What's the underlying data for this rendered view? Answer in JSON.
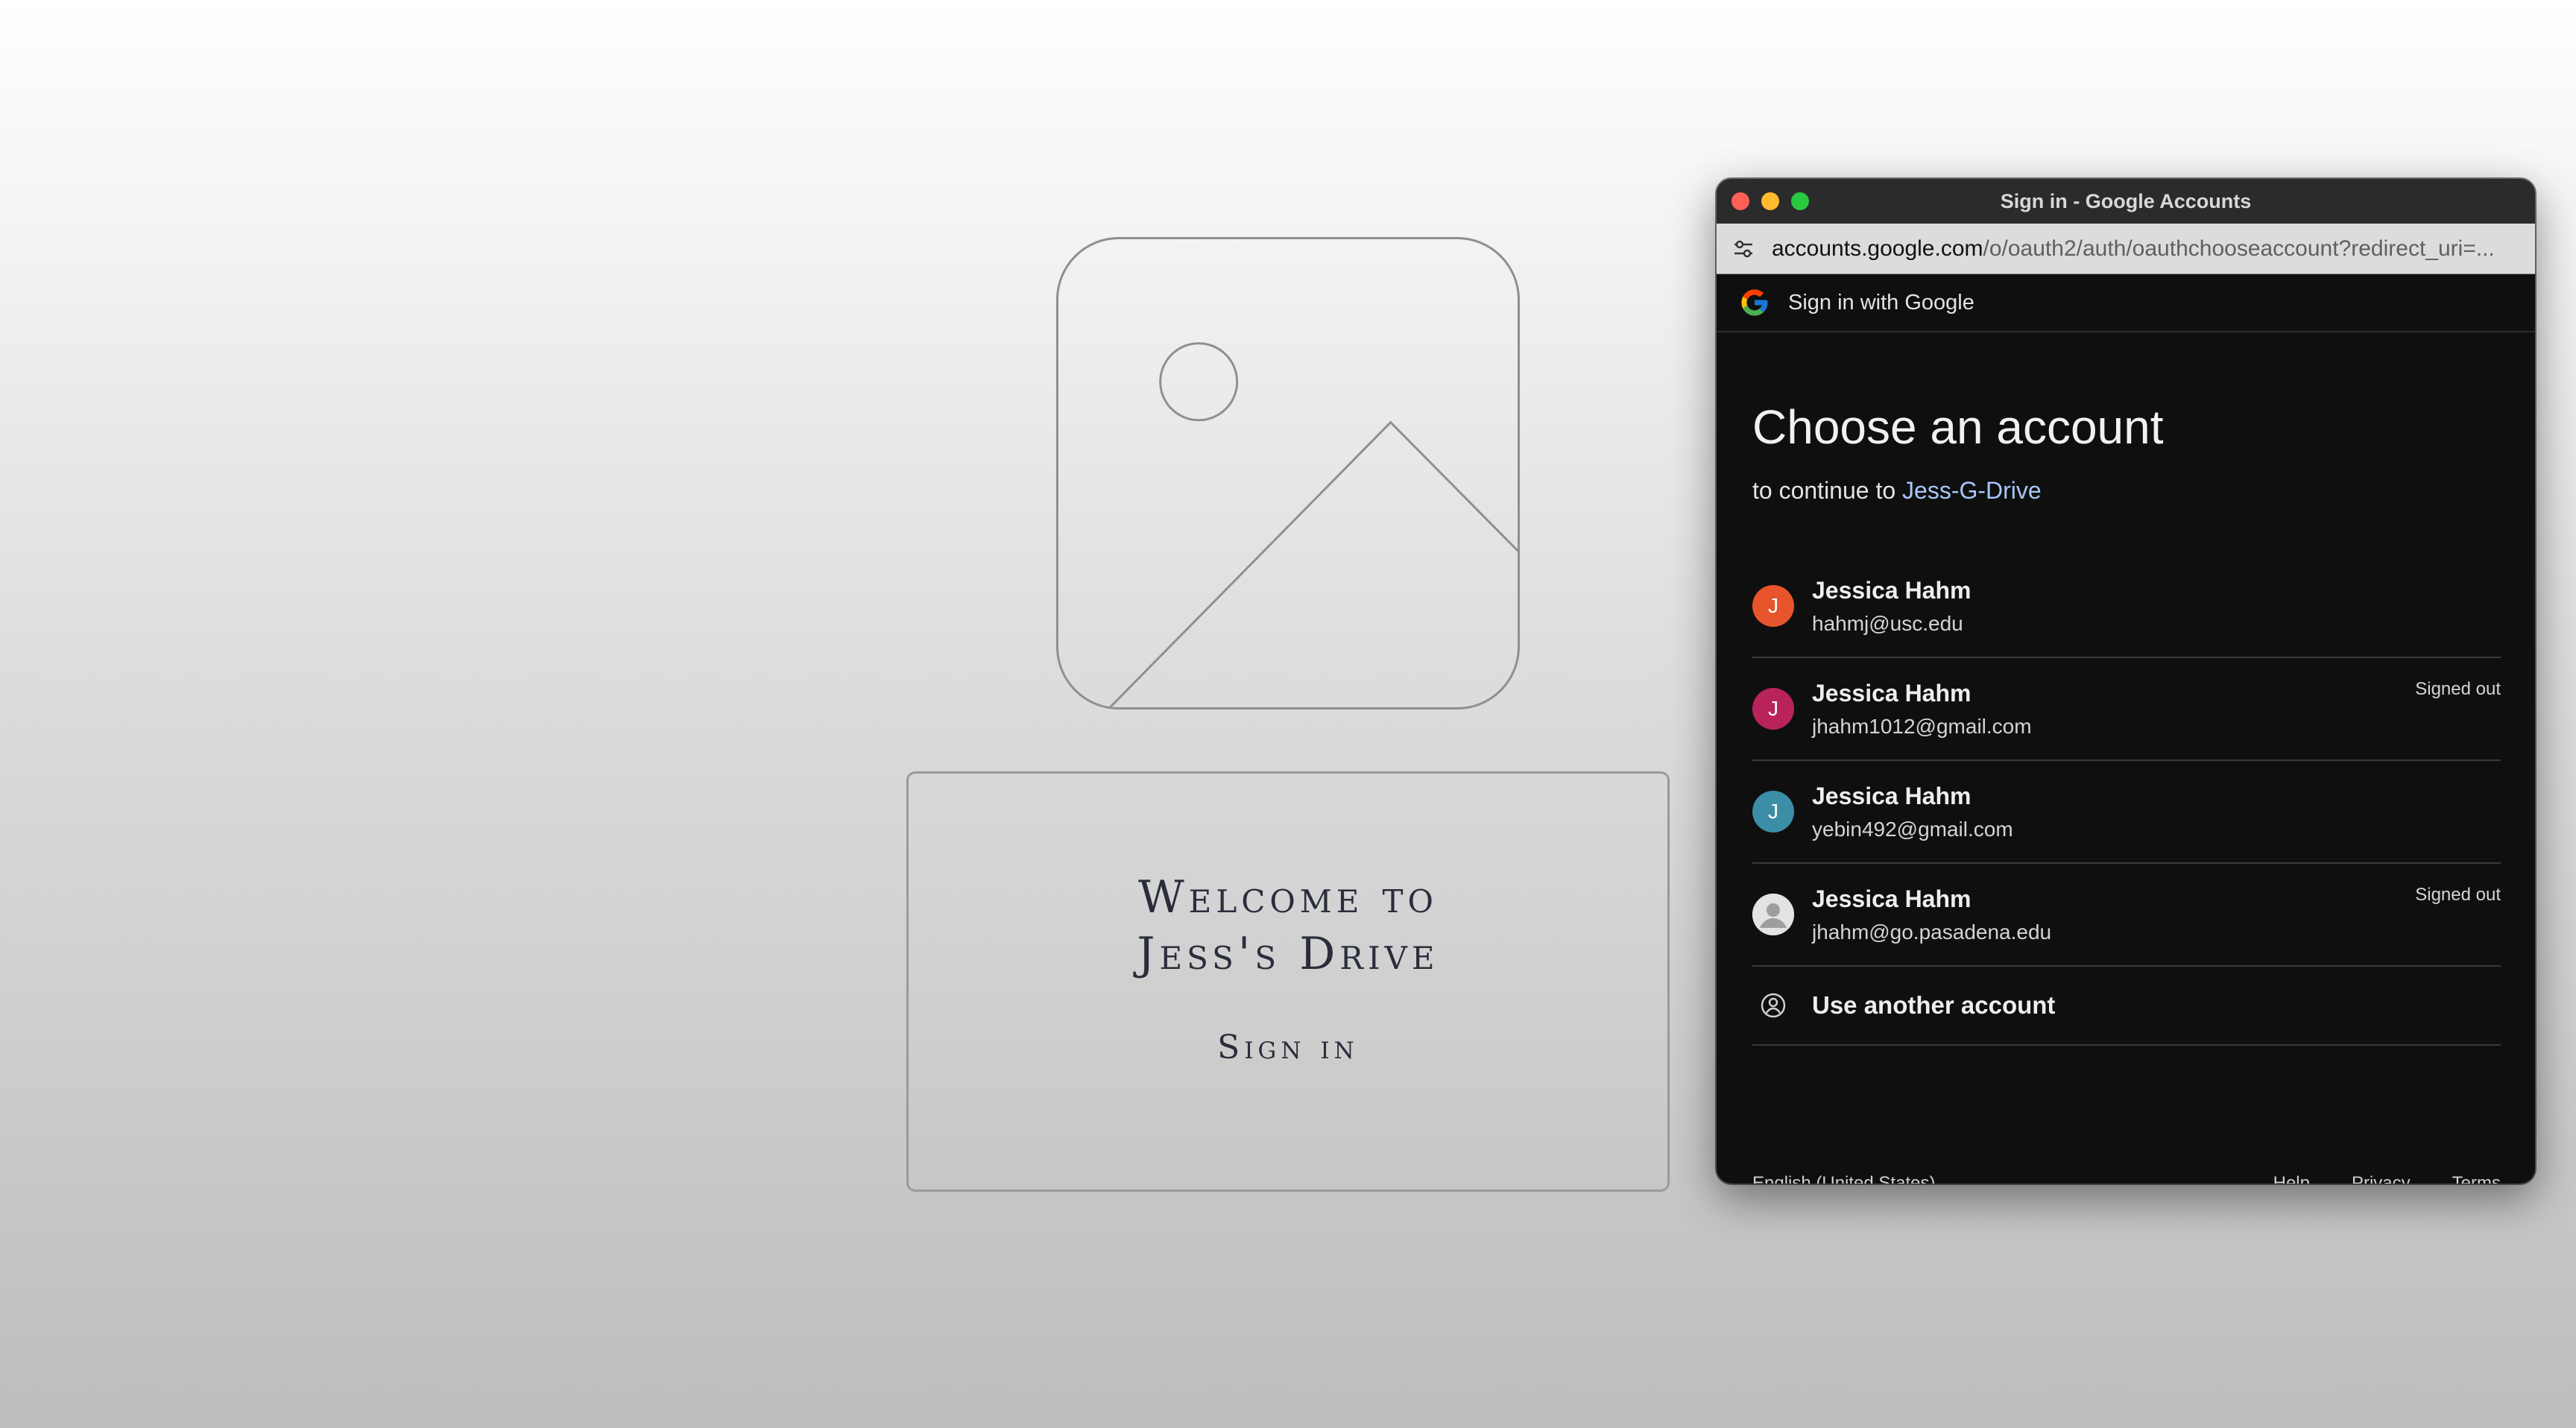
{
  "background_app": {
    "welcome_line1": "Welcome to",
    "welcome_line2": "Jess's Drive",
    "sign_in_label": "Sign in",
    "image_placeholder_icon": "image-placeholder-icon"
  },
  "popup": {
    "window_title": "Sign in - Google Accounts",
    "url_domain": "accounts.google.com",
    "url_path": "/o/oauth2/auth/oauthchooseaccount?redirect_uri=...",
    "header_label": "Sign in with Google",
    "title": "Choose an account",
    "continue_prefix": "to continue to",
    "app_name": "Jess-G-Drive",
    "accounts": [
      {
        "initial": "J",
        "name": "Jessica Hahm",
        "email": "hahmj@usc.edu",
        "status": "",
        "color": "#e8542b"
      },
      {
        "initial": "J",
        "name": "Jessica Hahm",
        "email": "jhahm1012@gmail.com",
        "status": "Signed out",
        "color": "#b7235a"
      },
      {
        "initial": "J",
        "name": "Jessica Hahm",
        "email": "yebin492@gmail.com",
        "status": "",
        "color": "#3b8ea5"
      },
      {
        "initial": "",
        "name": "Jessica Hahm",
        "email": "jhahm@go.pasadena.edu",
        "status": "Signed out",
        "color": "#e0e0e0"
      }
    ],
    "use_another": "Use another account",
    "footer": {
      "language": "English (United States)",
      "help": "Help",
      "privacy": "Privacy",
      "terms": "Terms"
    }
  },
  "colors": {
    "link_blue": "#a8c7fa",
    "popup_bg": "#0f0f0f",
    "close": "#fe5f57",
    "minimize": "#febc2e",
    "maximize": "#28c840"
  }
}
